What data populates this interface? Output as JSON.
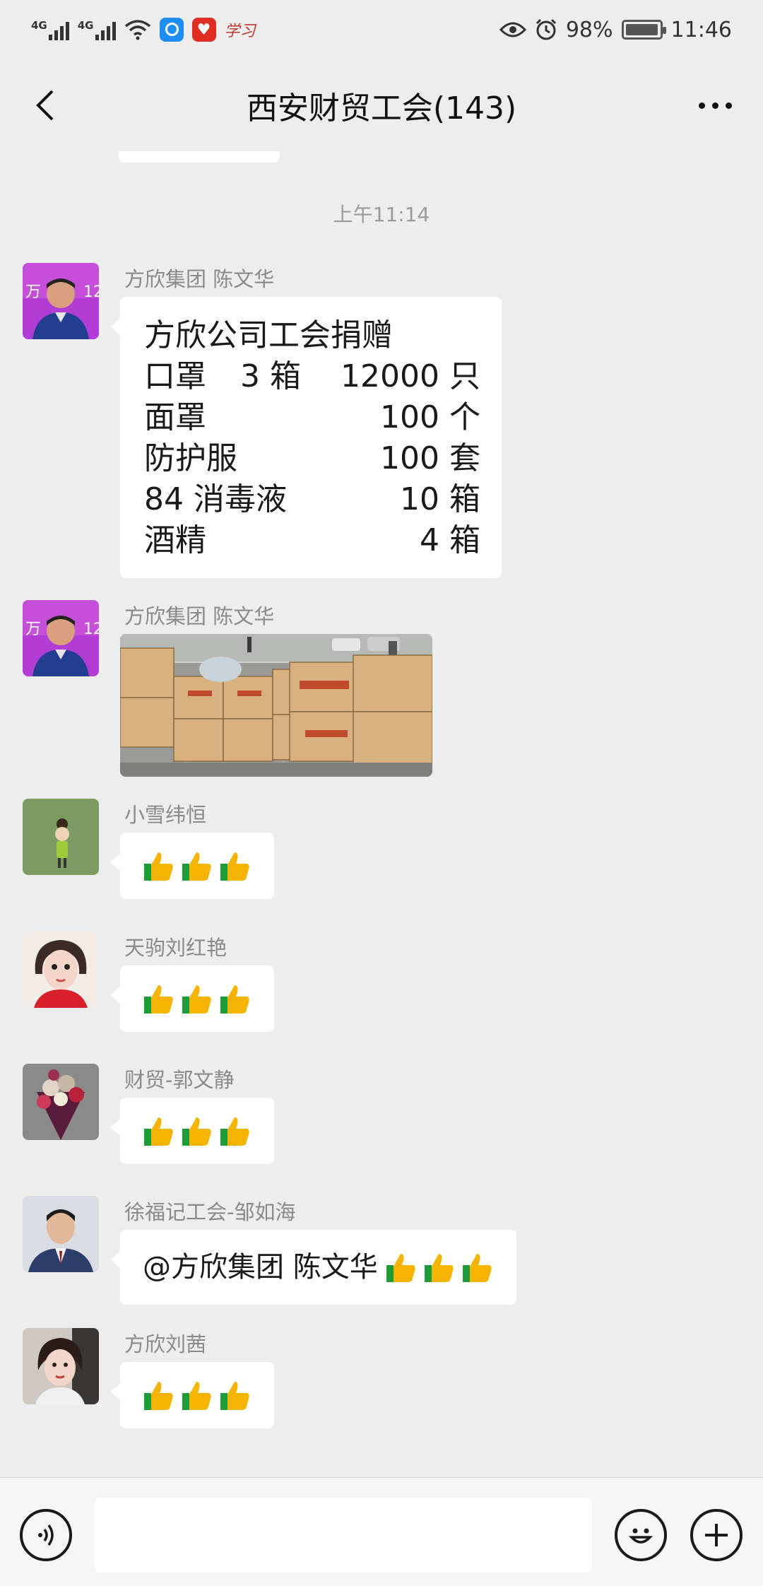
{
  "status_bar": {
    "network_1": "4G",
    "network_2": "4G",
    "app_badge": "学习",
    "battery": "98%",
    "battery_level": 0.98,
    "time": "11:46"
  },
  "nav": {
    "title": "西安财贸工会(143)"
  },
  "timestamp": "上午11:14",
  "messages": [
    {
      "sender": "方欣集团  陈文华",
      "type": "text",
      "title": "方欣公司工会捐赠",
      "rows": [
        {
          "item": "口罩",
          "sub": "3 箱",
          "qty": "12000 只"
        },
        {
          "item": "面罩",
          "sub": "",
          "qty": "100 个"
        },
        {
          "item": "防护服",
          "sub": "",
          "qty": "100 套"
        },
        {
          "item": "84 消毒液",
          "sub": "",
          "qty": "10 箱"
        },
        {
          "item": "酒精",
          "sub": "",
          "qty": "4 箱"
        }
      ]
    },
    {
      "sender": "方欣集团  陈文华",
      "type": "image"
    },
    {
      "sender": "小雪纬恒",
      "type": "emoji"
    },
    {
      "sender": "天驹刘红艳",
      "type": "emoji"
    },
    {
      "sender": "财贸-郭文静",
      "type": "emoji"
    },
    {
      "sender": "徐福记工会-邹如海",
      "type": "mention",
      "text": "@方欣集团  陈文华"
    },
    {
      "sender": "方欣刘茜",
      "type": "emoji"
    }
  ],
  "input": {
    "placeholder": ""
  },
  "colors": {
    "background": "#ededed",
    "bubble": "#ffffff",
    "sender": "#8a8a8a",
    "thumb": "#f5b400"
  }
}
